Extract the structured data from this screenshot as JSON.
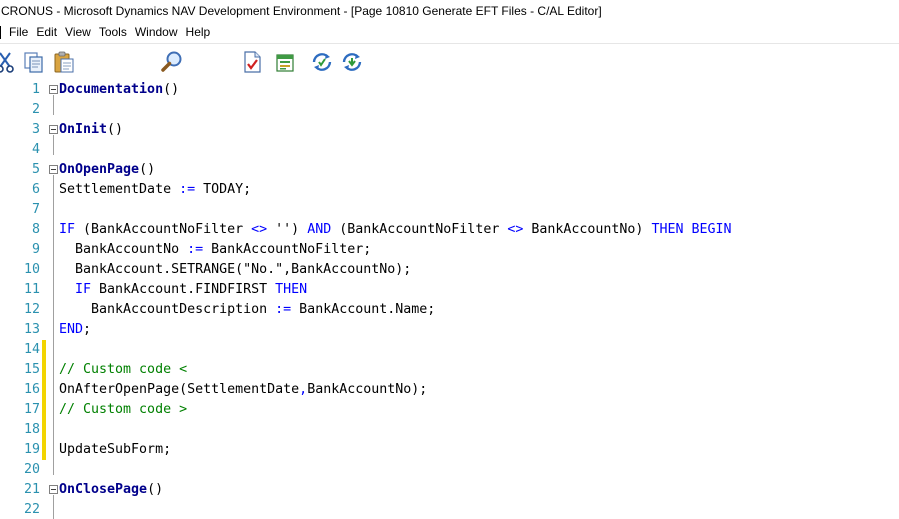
{
  "window": {
    "title": "CRONUS - Microsoft Dynamics NAV Development Environment - [Page 10810 Generate EFT Files - C/AL Editor]"
  },
  "menu": [
    "File",
    "Edit",
    "View",
    "Tools",
    "Window",
    "Help"
  ],
  "toolbar": [
    {
      "icon": "cut-icon"
    },
    {
      "icon": "copy-icon"
    },
    {
      "icon": "paste-icon"
    },
    {
      "icon": "find-icon"
    },
    {
      "icon": "compile-icon"
    },
    {
      "icon": "symbol-menu-icon"
    },
    {
      "icon": "run-icon"
    },
    {
      "icon": "debug-icon"
    }
  ],
  "editor": {
    "lines": [
      {
        "n": "1",
        "fold": true,
        "mod": false,
        "segs": [
          {
            "t": "Documentation",
            "c": "fn"
          },
          {
            "t": "()",
            "c": "id"
          }
        ]
      },
      {
        "n": "2",
        "fold": false,
        "mod": false,
        "segs": []
      },
      {
        "n": "3",
        "fold": true,
        "mod": false,
        "segs": [
          {
            "t": "OnInit",
            "c": "fn"
          },
          {
            "t": "()",
            "c": "id"
          }
        ]
      },
      {
        "n": "4",
        "fold": false,
        "mod": false,
        "segs": []
      },
      {
        "n": "5",
        "fold": true,
        "mod": false,
        "segs": [
          {
            "t": "OnOpenPage",
            "c": "fn"
          },
          {
            "t": "()",
            "c": "id"
          }
        ]
      },
      {
        "n": "6",
        "fold": false,
        "mod": false,
        "segs": [
          {
            "t": "SettlementDate ",
            "c": "id"
          },
          {
            "t": ":=",
            "c": "op"
          },
          {
            "t": " TODAY;",
            "c": "id"
          }
        ]
      },
      {
        "n": "7",
        "fold": false,
        "mod": false,
        "segs": []
      },
      {
        "n": "8",
        "fold": false,
        "mod": false,
        "segs": [
          {
            "t": "IF",
            "c": "kw"
          },
          {
            "t": " (BankAccountNoFilter ",
            "c": "id"
          },
          {
            "t": "<>",
            "c": "op"
          },
          {
            "t": " '') ",
            "c": "id"
          },
          {
            "t": "AND",
            "c": "kw"
          },
          {
            "t": " (BankAccountNoFilter ",
            "c": "id"
          },
          {
            "t": "<>",
            "c": "op"
          },
          {
            "t": " BankAccountNo) ",
            "c": "id"
          },
          {
            "t": "THEN BEGIN",
            "c": "kw"
          }
        ]
      },
      {
        "n": "9",
        "fold": false,
        "mod": false,
        "segs": [
          {
            "t": "  BankAccountNo ",
            "c": "id"
          },
          {
            "t": ":=",
            "c": "op"
          },
          {
            "t": " BankAccountNoFilter;",
            "c": "id"
          }
        ]
      },
      {
        "n": "10",
        "fold": false,
        "mod": false,
        "segs": [
          {
            "t": "  BankAccount.SETRANGE(\"No.\",BankAccountNo);",
            "c": "id"
          }
        ]
      },
      {
        "n": "11",
        "fold": false,
        "mod": false,
        "segs": [
          {
            "t": "  ",
            "c": "id"
          },
          {
            "t": "IF",
            "c": "kw"
          },
          {
            "t": " BankAccount.FINDFIRST ",
            "c": "id"
          },
          {
            "t": "THEN",
            "c": "kw"
          }
        ]
      },
      {
        "n": "12",
        "fold": false,
        "mod": false,
        "segs": [
          {
            "t": "    BankAccountDescription ",
            "c": "id"
          },
          {
            "t": ":=",
            "c": "op"
          },
          {
            "t": " BankAccount.Name;",
            "c": "id"
          }
        ]
      },
      {
        "n": "13",
        "fold": false,
        "mod": false,
        "segs": [
          {
            "t": "END",
            "c": "kw"
          },
          {
            "t": ";",
            "c": "id"
          }
        ]
      },
      {
        "n": "14",
        "fold": false,
        "mod": true,
        "segs": []
      },
      {
        "n": "15",
        "fold": false,
        "mod": true,
        "segs": [
          {
            "t": "// Custom code <",
            "c": "cm"
          }
        ]
      },
      {
        "n": "16",
        "fold": false,
        "mod": true,
        "segs": [
          {
            "t": "OnAfterOpenPage(SettlementDate",
            "c": "id"
          },
          {
            "t": ",",
            "c": "op"
          },
          {
            "t": "BankAccountNo);",
            "c": "id"
          }
        ]
      },
      {
        "n": "17",
        "fold": false,
        "mod": true,
        "segs": [
          {
            "t": "// Custom code >",
            "c": "cm"
          }
        ]
      },
      {
        "n": "18",
        "fold": false,
        "mod": true,
        "segs": []
      },
      {
        "n": "19",
        "fold": false,
        "mod": true,
        "segs": [
          {
            "t": "UpdateSubForm;",
            "c": "id"
          }
        ]
      },
      {
        "n": "20",
        "fold": false,
        "mod": false,
        "segs": []
      },
      {
        "n": "21",
        "fold": true,
        "mod": false,
        "segs": [
          {
            "t": "OnClosePage",
            "c": "fn"
          },
          {
            "t": "()",
            "c": "id"
          }
        ]
      },
      {
        "n": "22",
        "fold": false,
        "mod": false,
        "segs": []
      }
    ]
  },
  "colors": {
    "line_number": "#2b91af",
    "function_name": "#00008b",
    "keyword": "#0000ff",
    "comment": "#008000",
    "change_marker": "#f2d400"
  }
}
